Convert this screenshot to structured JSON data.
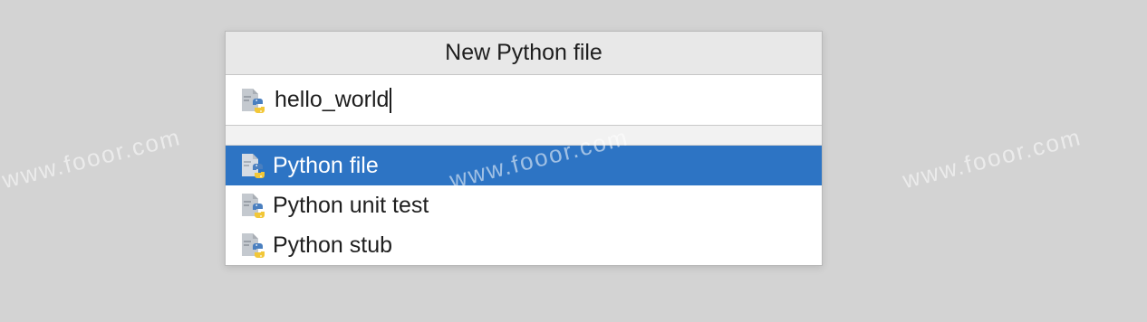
{
  "dialog": {
    "title": "New Python file",
    "name_value": "hello_world"
  },
  "file_types": [
    {
      "label": "Python file",
      "icon": "python-file-icon",
      "selected": true
    },
    {
      "label": "Python unit test",
      "icon": "python-file-icon",
      "selected": false
    },
    {
      "label": "Python stub",
      "icon": "python-file-icon",
      "selected": false
    }
  ],
  "watermark": "www.fooor.com",
  "colors": {
    "selection": "#2d74c4",
    "background": "#d3d3d3",
    "title_bar": "#e8e8e8",
    "python_blue": "#4a7fbf",
    "python_yellow": "#f2c738"
  }
}
